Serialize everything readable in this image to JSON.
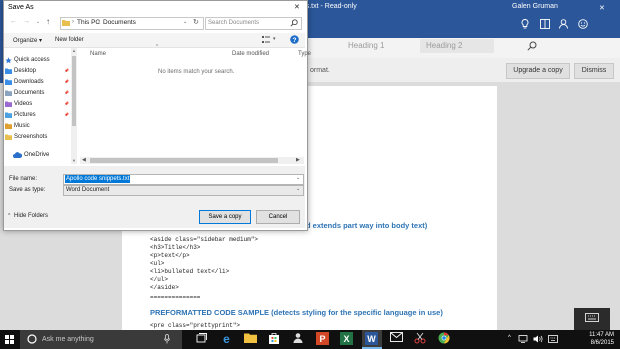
{
  "word": {
    "title": "pets.txt - Read-only",
    "user": "Galen Gruman",
    "styles": [
      "Heading 1",
      "Heading 2"
    ],
    "message_fragment": "ormat.",
    "upgrade_label": "Upgrade a copy",
    "dismiss_label": "Dismiss",
    "doc": {
      "heading1_fragment": "d extends part way into body text)",
      "code1": "<aside class=\"sidebar medium\">\n<h3>Title</h3>\n<p>text</p>\n<ul>\n<li>bulleted text</li>\n</ul>\n</aside>",
      "separator": "==============",
      "heading2": "PREFORMATTED CODE SAMPLE (detects styling for the specific language in use)",
      "code2": "<pre class=\"prettyprint\">"
    }
  },
  "dialog": {
    "title": "Save As",
    "breadcrumb": [
      "This PC",
      "Documents"
    ],
    "search_placeholder": "Search Documents",
    "organize_label": "Organize ▾",
    "new_folder_label": "New folder",
    "columns": [
      "Name",
      "Date modified",
      "Type"
    ],
    "empty_message": "No items match your search.",
    "nav_items": [
      {
        "label": "Quick access",
        "icon": "star-icon",
        "color": "#2f78d4"
      },
      {
        "label": "Desktop",
        "icon": "desktop-folder-icon",
        "color": "#3a8ee6",
        "pinned": true
      },
      {
        "label": "Downloads",
        "icon": "download-folder-icon",
        "color": "#3a8ee6",
        "pinned": true
      },
      {
        "label": "Documents",
        "icon": "documents-folder-icon",
        "color": "#8aa4c0",
        "pinned": true
      },
      {
        "label": "Videos",
        "icon": "videos-folder-icon",
        "color": "#9a6ad0",
        "pinned": true
      },
      {
        "label": "Pictures",
        "icon": "pictures-folder-icon",
        "color": "#4aa0e0",
        "pinned": true
      },
      {
        "label": "Music",
        "icon": "music-folder-icon",
        "color": "#e0a030"
      },
      {
        "label": "Screenshots",
        "icon": "folder-icon",
        "color": "#e8c050"
      },
      {
        "label": "OneDrive",
        "icon": "cloud-icon",
        "color": "#2a6fc9"
      }
    ],
    "file_name_label": "File name:",
    "file_name_value": "Apollo code snippets.txt",
    "save_type_label": "Save as type:",
    "save_type_value": "Word Document",
    "hide_folders_label": "Hide Folders",
    "save_label": "Save a copy",
    "cancel_label": "Cancel"
  },
  "taskbar": {
    "search_placeholder": "Ask me anything",
    "time": "11:47 AM",
    "date": "8/6/2015"
  },
  "colors": {
    "word_blue": "#2b579a",
    "accent": "#0078d7",
    "heading_blue": "#2e74b5"
  }
}
